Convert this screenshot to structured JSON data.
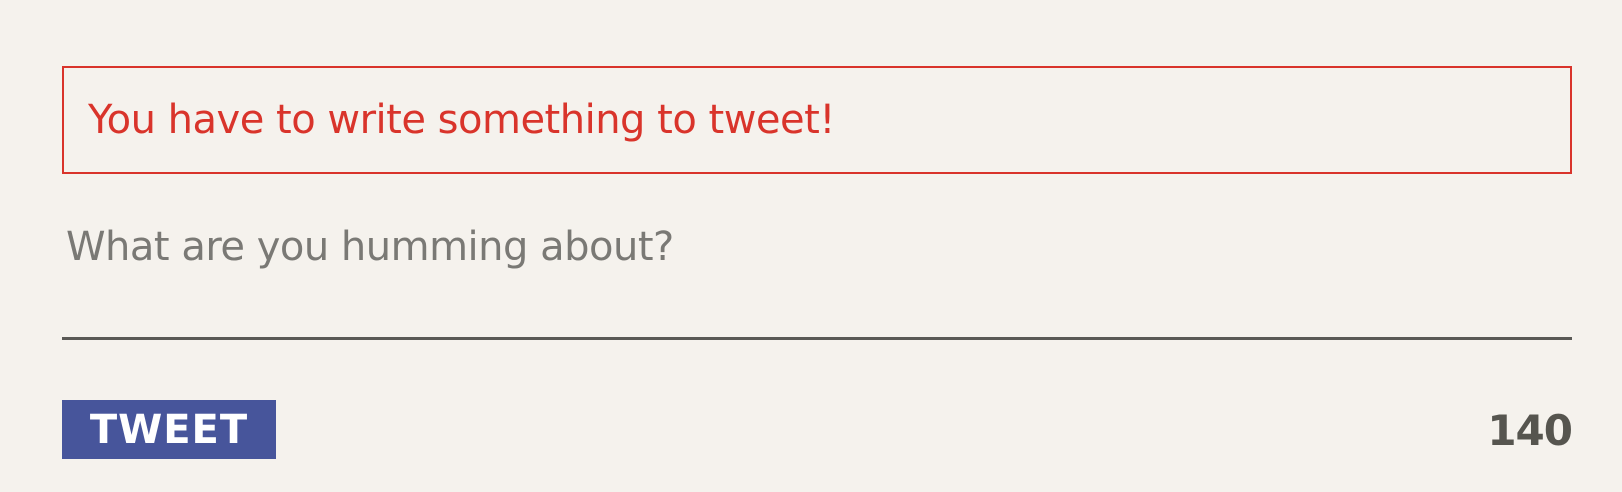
{
  "error": {
    "message": "You have to write something to tweet!"
  },
  "compose": {
    "placeholder": "What are you humming about?",
    "value": ""
  },
  "tweet_button": {
    "label": "TWEET"
  },
  "char_counter": {
    "remaining": "140"
  },
  "colors": {
    "background": "#f5f2ed",
    "error": "#d9342b",
    "button": "#47559b",
    "counter": "#56554f",
    "underline": "#5a5955"
  }
}
